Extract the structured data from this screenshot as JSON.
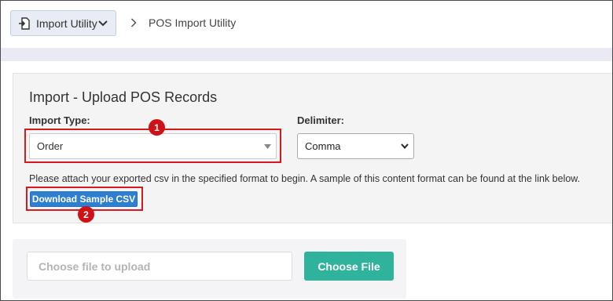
{
  "header": {
    "module_button_label": "Import Utility",
    "breadcrumb_current": "POS Import Utility"
  },
  "panel": {
    "title": "Import - Upload POS Records",
    "import_type": {
      "label": "Import Type:",
      "selected": "Order"
    },
    "delimiter": {
      "label": "Delimiter:",
      "selected": "Comma"
    },
    "help_text": "Please attach your exported csv in the specified format to begin. A sample of this content format can be found at the link below.",
    "download_button_label": "Download Sample CSV"
  },
  "annotations": {
    "badge_1": "1",
    "badge_2": "2",
    "callout_color": "#d6181f"
  },
  "upload": {
    "file_placeholder": "Choose file to upload",
    "choose_button_label": "Choose File"
  },
  "colors": {
    "primary_button": "#2e7fcf",
    "choose_file_button": "#2fb39c",
    "module_button_bg": "#e8ecf4"
  },
  "icons": {
    "module": "import-document-icon",
    "module_dropdown": "chevron-down-icon",
    "breadcrumb_separator": "chevron-right-icon",
    "select_caret": "caret-down-icon"
  }
}
